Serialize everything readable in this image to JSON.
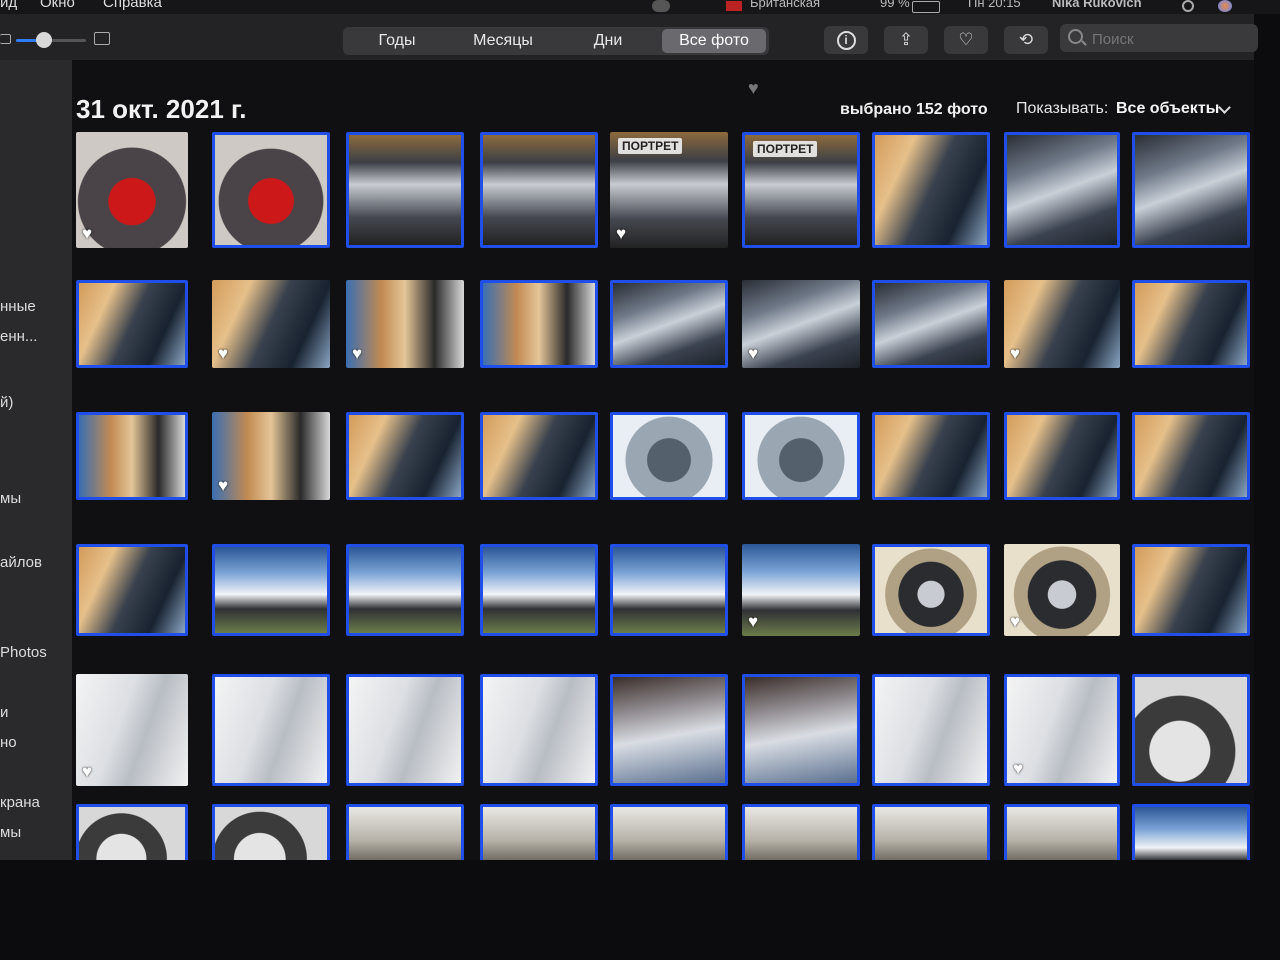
{
  "menubar": {
    "items": [
      "ид",
      "Окно",
      "Справка"
    ],
    "keyboard": "Британская",
    "battery": "99 %",
    "clock": "Пн 20:15",
    "user": "Nika Rukovich"
  },
  "toolbar": {
    "tabs": [
      "Годы",
      "Месяцы",
      "Дни",
      "Все фото"
    ],
    "active_tab": "Все фото",
    "search_placeholder": "Поиск",
    "zoom_level_fraction": 0.4,
    "accent_color": "#1f4fe8",
    "buttons": [
      "info-icon",
      "share-icon",
      "heart-icon",
      "rotate-icon"
    ]
  },
  "sidebar": {
    "items": [
      "нные",
      "енн...",
      "й)",
      "мы",
      "айлов",
      "Photos",
      "и",
      "но",
      "крана",
      "мы"
    ]
  },
  "content": {
    "date_title": "31 окт. 2021 г.",
    "selected_count": "выбрано 152 фото",
    "show_label": "Показывать:",
    "show_value": "Все объекты",
    "rows": [
      [
        {
          "kind": "dash",
          "sel": false,
          "fav": true
        },
        {
          "kind": "dash",
          "sel": true,
          "fav": false
        },
        {
          "kind": "cons",
          "sel": true,
          "fav": false
        },
        {
          "kind": "cons",
          "sel": true,
          "fav": false
        },
        {
          "kind": "cons",
          "sel": false,
          "fav": true,
          "badge": "ПОРТРЕТ"
        },
        {
          "kind": "cons",
          "sel": true,
          "fav": false,
          "badge": "ПОРТРЕТ"
        },
        {
          "kind": "int",
          "sel": true,
          "fav": false
        },
        {
          "kind": "seat",
          "sel": true,
          "fav": false
        },
        {
          "kind": "seat",
          "sel": true,
          "fav": false
        }
      ],
      [
        {
          "kind": "int",
          "sel": true,
          "fav": false
        },
        {
          "kind": "int",
          "sel": false,
          "fav": true
        },
        {
          "kind": "door",
          "sel": false,
          "fav": true
        },
        {
          "kind": "door",
          "sel": true,
          "fav": false
        },
        {
          "kind": "seat",
          "sel": true,
          "fav": false
        },
        {
          "kind": "seat",
          "sel": false,
          "fav": true
        },
        {
          "kind": "seat",
          "sel": true,
          "fav": false
        },
        {
          "kind": "int",
          "sel": false,
          "fav": true
        },
        {
          "kind": "int",
          "sel": true,
          "fav": false
        }
      ],
      [
        {
          "kind": "door",
          "sel": true,
          "fav": false
        },
        {
          "kind": "door",
          "sel": false,
          "fav": true
        },
        {
          "kind": "int",
          "sel": true,
          "fav": false
        },
        {
          "kind": "int",
          "sel": true,
          "fav": false
        },
        {
          "kind": "eng",
          "sel": true,
          "fav": false
        },
        {
          "kind": "eng",
          "sel": true,
          "fav": false
        },
        {
          "kind": "int",
          "sel": true,
          "fav": false
        },
        {
          "kind": "int",
          "sel": true,
          "fav": false
        },
        {
          "kind": "int",
          "sel": true,
          "fav": false
        }
      ],
      [
        {
          "kind": "int",
          "sel": true,
          "fav": false
        },
        {
          "kind": "car",
          "sel": true,
          "fav": false
        },
        {
          "kind": "car",
          "sel": true,
          "fav": false
        },
        {
          "kind": "car",
          "sel": true,
          "fav": false
        },
        {
          "kind": "car",
          "sel": true,
          "fav": false
        },
        {
          "kind": "car",
          "sel": false,
          "fav": true
        },
        {
          "kind": "wheel",
          "sel": true,
          "fav": false
        },
        {
          "kind": "wheel",
          "sel": false,
          "fav": true
        },
        {
          "kind": "int",
          "sel": true,
          "fav": false
        }
      ],
      [
        {
          "kind": "body",
          "sel": false,
          "fav": true
        },
        {
          "kind": "body",
          "sel": true,
          "fav": false
        },
        {
          "kind": "body",
          "sel": true,
          "fav": false
        },
        {
          "kind": "body",
          "sel": true,
          "fav": false
        },
        {
          "kind": "roof",
          "sel": true,
          "fav": false
        },
        {
          "kind": "roof",
          "sel": true,
          "fav": false
        },
        {
          "kind": "body",
          "sel": true,
          "fav": false
        },
        {
          "kind": "body",
          "sel": true,
          "fav": true
        },
        {
          "kind": "tire",
          "sel": true,
          "fav": false
        }
      ],
      [
        {
          "kind": "tire",
          "sel": true,
          "fav": false
        },
        {
          "kind": "tire",
          "sel": true,
          "fav": false
        },
        {
          "kind": "under",
          "sel": true,
          "fav": false
        },
        {
          "kind": "under",
          "sel": true,
          "fav": false
        },
        {
          "kind": "under",
          "sel": true,
          "fav": false
        },
        {
          "kind": "under",
          "sel": true,
          "fav": false
        },
        {
          "kind": "under",
          "sel": true,
          "fav": false
        },
        {
          "kind": "under",
          "sel": true,
          "fav": false
        },
        {
          "kind": "car",
          "sel": true,
          "fav": false
        }
      ]
    ]
  }
}
